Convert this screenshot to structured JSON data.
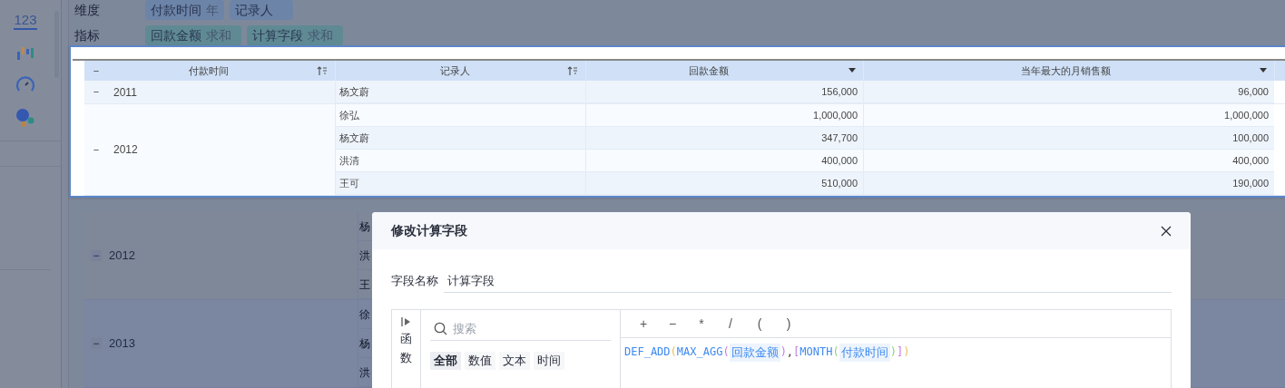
{
  "sidebar": {
    "icons": [
      {
        "kind": "number",
        "label": "123",
        "selected": true
      },
      {
        "kind": "bars",
        "selected": false
      },
      {
        "kind": "gauge",
        "selected": false
      },
      {
        "kind": "bubbles",
        "selected": false
      }
    ]
  },
  "shelves": [
    {
      "label": "维度",
      "chips": [
        {
          "name": "付款时间",
          "agg": "年"
        },
        {
          "name": "记录人"
        }
      ]
    },
    {
      "label": "指标",
      "chips": [
        {
          "name": "回款金额",
          "agg": "求和"
        },
        {
          "name": "计算字段",
          "agg": "求和"
        }
      ]
    }
  ],
  "background_table": {
    "groups": [
      {
        "toggle": "−",
        "year": "2012",
        "names": [
          "杨",
          "洪",
          "王"
        ]
      },
      {
        "toggle": "−",
        "year": "2013",
        "names": [
          "徐",
          "杨",
          "洪"
        ]
      }
    ]
  },
  "preview_table": {
    "toggle": "−",
    "columns": [
      {
        "label": "付款时间",
        "kind": "sort"
      },
      {
        "label": "记录人",
        "kind": "sort"
      },
      {
        "label": "回款金额",
        "kind": "menu"
      },
      {
        "label": "当年最大的月销售额",
        "kind": "menu"
      }
    ],
    "groups": [
      {
        "toggle": "−",
        "year": "2011",
        "rows": [
          {
            "name": "杨文蔚",
            "amount": "156,000",
            "max": "96,000"
          }
        ]
      },
      {
        "toggle": "−",
        "year": "2012",
        "rows": [
          {
            "name": "徐弘",
            "amount": "1,000,000",
            "max": "1,000,000"
          },
          {
            "name": "杨文蔚",
            "amount": "347,700",
            "max": "100,000"
          },
          {
            "name": "洪清",
            "amount": "400,000",
            "max": "400,000"
          },
          {
            "name": "王可",
            "amount": "510,000",
            "max": "190,000"
          }
        ]
      }
    ]
  },
  "dialog": {
    "title": "修改计算字段",
    "field_label": "字段名称",
    "field_value": "计算字段",
    "side_tab": "函数",
    "search_placeholder": "搜索",
    "categories": [
      {
        "label": "全部",
        "selected": true
      },
      {
        "label": "数值",
        "selected": false
      },
      {
        "label": "文本",
        "selected": false
      },
      {
        "label": "时间",
        "selected": false
      }
    ],
    "operators": [
      "+",
      "−",
      "*",
      "/",
      "(",
      ")"
    ],
    "formula": [
      {
        "kind": "func",
        "text": "DEF_ADD"
      },
      {
        "kind": "paren",
        "text": "(",
        "color": "#e8c15a"
      },
      {
        "kind": "func",
        "text": "MAX_AGG"
      },
      {
        "kind": "paren",
        "text": "(",
        "color": "#c77be0"
      },
      {
        "kind": "field",
        "text": "回款金额"
      },
      {
        "kind": "paren",
        "text": ")",
        "color": "#c77be0"
      },
      {
        "kind": "punct",
        "text": ","
      },
      {
        "kind": "paren",
        "text": "[",
        "color": "#c77be0"
      },
      {
        "kind": "func",
        "text": "MONTH"
      },
      {
        "kind": "paren",
        "text": "(",
        "color": "#8fd07a"
      },
      {
        "kind": "field",
        "text": "付款时间"
      },
      {
        "kind": "paren",
        "text": ")",
        "color": "#8fd07a"
      },
      {
        "kind": "paren",
        "text": "]",
        "color": "#c77be0"
      },
      {
        "kind": "paren",
        "text": ")",
        "color": "#e8c15a"
      }
    ]
  }
}
